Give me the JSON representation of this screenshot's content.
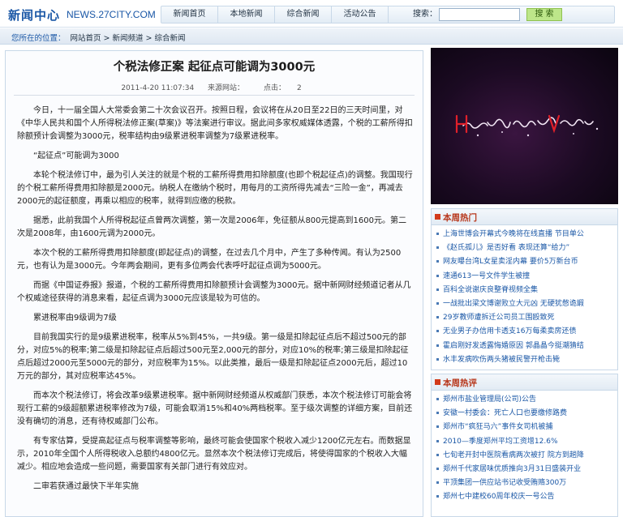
{
  "header": {
    "logo": "新闻中心",
    "domain": "NEWS.27CITY.COM",
    "nav": [
      "新闻首页",
      "本地新闻",
      "综合新闻",
      "活动公告"
    ],
    "search_label": "搜索：",
    "search_value": "",
    "search_button": "搜 索"
  },
  "breadcrumb": {
    "label": "您所在的位置：",
    "trail": "网站首页 > 新闻频道 > 综合新闻"
  },
  "article": {
    "title": "个税法修正案 起征点可能调为3000元",
    "date": "2011-4-20 11:07:34",
    "source_label": "来源网站：",
    "clicks_label": "点击：",
    "clicks": "2",
    "paragraphs": [
      "今日，十一届全国人大常委会第二十次会议召开。按照日程，会议将在从20日至22日的三天时间里，对《中华人民共和国个人所得税法修正案(草案)》等法案进行审议。据此间多家权威媒体透露，个税的工薪所得扣除额预计会调整为3000元，税率结构由9级累进税率调整为7级累进税率。",
      "“起征点”可能调为3000",
      "本轮个税法修订中，最为引人关注的就是个税的工薪所得费用扣除额度(也即个税起征点)的调整。我国现行的个税工薪所得费用扣除额是2000元。纳税人在缴纳个税时，用每月的工资所得先减去“三险一金”，再减去2000元的起征额度，再乘以相应的税率，就得到应缴的税款。",
      "据悉，此前我国个人所得税起征点曾两次调整，第一次是2006年，免征额从800元提高到1600元。第二次是2008年，由1600元调为2000元。",
      "本次个税的工薪所得费用扣除额度(即起征点)的调整，在过去几个月中，产生了多种传闻。有认为2500元，也有认为是3000元。今年两会期间，更有多位两会代表呼吁起征点调为5000元。",
      "而据《中国证券报》报道，个税的工薪所得费用扣除额预计会调整为3000元。据中新网财经频道记者从几个权威途径获得的消息来看，起征点调为3000元应该是较为可信的。",
      "累进税率由9级调为7级",
      "目前我国实行的是9级累进税率，税率从5%到45%，一共9级。第一级是扣除起征点后不超过500元的部分，对应5%的税率;第二级是扣除起征点后超过500元至2,000元的部分，对应10%的税率;第三级是扣除起征点后超过2000元至5000元的部分，对应税率为15%。以此类推，最后一级是扣除起征点2000元后，超过10万元的部分，其对应税率达45%。",
      "而本次个税法修订，将会改革9级累进税率。据中新网财经频道从权威部门获悉，本次个税法修订可能会将现行工薪的9级超额累进税率修改为7级，可能会取消15%和40%两档税率。至于级次调整的详细方案，目前还没有确切的消息，还有待权威部门公布。",
      "有专家估算，受提高起征点与税率调整等影响，最终可能会使国家个税收入减少1200亿元左右。而数据显示，2010年全国个人所得税收入总额约4800亿元。显然本次个税法修订完成后，将使得国家的个税收入大幅减少。相应地会造成一些问题，需要国家有关部门进行有效应对。",
      "二审若获通过最快下半年实施"
    ]
  },
  "hot_news": {
    "title": "本周热门",
    "items": [
      "上海世博会开幕式今晚将在线直播 节目单公",
      "《赵氏孤儿》是否好看 表现还算“给力”",
      "网友曝台湾L女星卖淫内幕 要价5万新台币",
      "速通613一号文件学生被撞",
      "百科全说谢庆良整脊视频全集",
      "一战批出梁文博谢败立大元凶 无硬犹憋诡嘏",
      "29岁教师遭拆迁公司员工围殴致死",
      "无业男子办信用卡透支16万每柔卖房还债",
      "霍启刚好发透露悔婚原因 郭晶晶今挺潮猜结",
      "水丰发病吹伤两头猪被民警开枪击毙"
    ]
  },
  "weekly_review": {
    "title": "本周热评",
    "items": [
      "郑州市盐业管理局(公司)公告",
      "安徽一村委会：死亡人口也要缴修路费",
      "郑州市“疯狂马六”事件女司机被捕",
      "2010—季度郑州平均工资增12.6%",
      "七旬老开封中医院看病两次被打 院方到趟降",
      "郑州千代家居味优质推向3月31日盛装开业",
      "平顶集团一供应站书记收受贿赂300万",
      "郑州七中建校60周年校庆一号公告"
    ]
  },
  "colors": {
    "accent_blue": "#1a57a6",
    "section_red": "#b7361a",
    "search_green": "#bde68a"
  }
}
